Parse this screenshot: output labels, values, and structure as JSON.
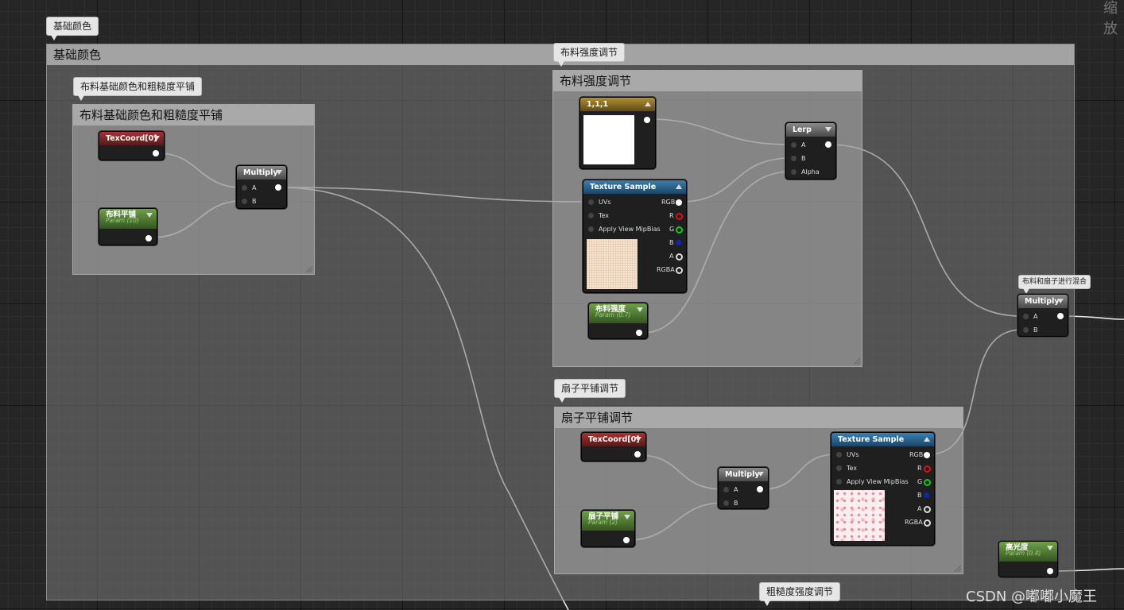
{
  "top_right_label": "缩放",
  "watermark": "CSDN @嘟嘟小魔王",
  "comments": {
    "base_color": {
      "bubble": "基础颜色",
      "title": "基础颜色"
    },
    "cloth_tiling": {
      "bubble": "布料基础颜色和粗糙度平铺",
      "title": "布料基础颜色和粗糙度平铺"
    },
    "cloth_strength": {
      "bubble": "布料强度调节",
      "title": "布料强度调节"
    },
    "fan_tiling": {
      "bubble": "扇子平铺调节",
      "title": "扇子平铺调节"
    },
    "roughness": {
      "bubble": "粗糙度强度调节"
    },
    "mix": {
      "bubble": "布料和扇子进行混合"
    }
  },
  "pins": {
    "uvs": "UVs",
    "tex": "Tex",
    "mip": "Apply View MipBias",
    "rgb": "RGB",
    "r": "R",
    "g": "G",
    "b": "B",
    "a": "A",
    "rgba": "RGBA",
    "alpha": "Alpha"
  },
  "nodes": {
    "texcoord1": {
      "title": "TexCoord[0]"
    },
    "cloth_tile_param": {
      "title": "布料平铺",
      "sub": "Param (10)"
    },
    "multiply1": {
      "title": "Multiply"
    },
    "const3": {
      "title": "1,1,1"
    },
    "texsample1": {
      "title": "Texture Sample"
    },
    "cloth_strength_param": {
      "title": "布料强度",
      "sub": "Param (0.7)"
    },
    "lerp": {
      "title": "Lerp"
    },
    "texcoord2": {
      "title": "TexCoord[0]"
    },
    "fan_tile_param": {
      "title": "扇子平铺",
      "sub": "Param (2)"
    },
    "multiply2": {
      "title": "Multiply"
    },
    "texsample2": {
      "title": "Texture Sample"
    },
    "multiply3": {
      "title": "Multiply"
    },
    "specular_param": {
      "title": "高光度",
      "sub": "Param (0.4)"
    }
  }
}
